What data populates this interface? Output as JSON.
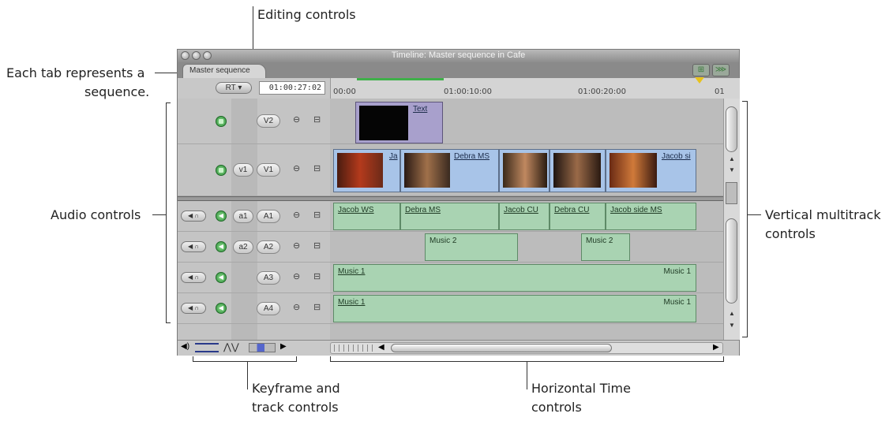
{
  "callouts": {
    "editing_controls": "Editing controls",
    "tab_note_line1": "Each tab represents a",
    "tab_note_line2": "sequence.",
    "audio_controls": "Audio controls",
    "vertical_multitrack_line1": "Vertical multitrack",
    "vertical_multitrack_line2": "controls",
    "keyframe_line1": "Keyframe and",
    "keyframe_line2": "track controls",
    "horizontal_line1": "Horizontal Time",
    "horizontal_line2": "controls"
  },
  "window": {
    "title": "Timeline: Master sequence in Cafe",
    "tab_label": "Master sequence",
    "rt_label": "RT ▾",
    "timecode": "01:00:27:02",
    "ruler_labels": [
      "00:00",
      "01:00:10:00",
      "01:00:20:00",
      "01"
    ],
    "accent_green": "#3fb04a",
    "playhead_color": "#e8c21c"
  },
  "tracks": {
    "video": [
      {
        "dest": "",
        "label": "V2"
      },
      {
        "dest": "v1",
        "label": "V1"
      }
    ],
    "audio": [
      {
        "dest": "a1",
        "label": "A1"
      },
      {
        "dest": "a2",
        "label": "A2"
      },
      {
        "dest": "",
        "label": "A3"
      },
      {
        "dest": "",
        "label": "A4"
      }
    ]
  },
  "clips": {
    "v2_text": "Text",
    "v1": [
      "Ja",
      "Debra MS",
      "",
      "",
      "Jacob si"
    ],
    "a1": [
      "Jacob WS",
      "Debra MS",
      "Jacob CU",
      "Debra CU",
      "Jacob side MS"
    ],
    "a2": [
      "Music 2",
      "Music 2"
    ],
    "a3": [
      "Music 1",
      "Music 1"
    ],
    "a4": [
      "Music 1",
      "Music 1"
    ]
  },
  "icons": {
    "lock": "lock-icon",
    "link": "link-icon",
    "visibility": "visibility-icon",
    "speaker": "speaker-icon",
    "headphones": "headphones-icon"
  }
}
